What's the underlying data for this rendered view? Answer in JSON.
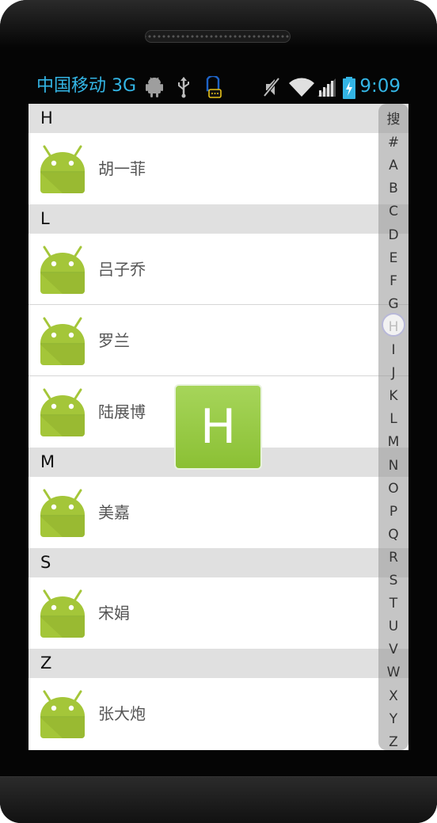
{
  "status_bar": {
    "carrier": "中国移动 3G",
    "time": "9:09",
    "icons": [
      "android-debug-icon",
      "usb-icon",
      "notification-icon",
      "mute-icon",
      "wifi-icon",
      "signal-icon",
      "battery-charging-icon"
    ]
  },
  "sections": [
    {
      "letter": "H",
      "contacts": [
        {
          "name": "胡一菲"
        }
      ]
    },
    {
      "letter": "L",
      "contacts": [
        {
          "name": "吕子乔"
        },
        {
          "name": "罗兰"
        },
        {
          "name": "陆展博"
        }
      ]
    },
    {
      "letter": "M",
      "contacts": [
        {
          "name": "美嘉"
        }
      ]
    },
    {
      "letter": "S",
      "contacts": [
        {
          "name": "宋娟"
        }
      ]
    },
    {
      "letter": "Z",
      "contacts": [
        {
          "name": "张大炮"
        }
      ]
    }
  ],
  "index_bar": {
    "items": [
      "搜",
      "#",
      "A",
      "B",
      "C",
      "D",
      "E",
      "F",
      "G",
      "H",
      "I",
      "J",
      "K",
      "L",
      "M",
      "N",
      "O",
      "P",
      "Q",
      "R",
      "S",
      "T",
      "U",
      "V",
      "W",
      "X",
      "Y",
      "Z"
    ],
    "selected": "H"
  },
  "overlay": {
    "letter": "H"
  },
  "colors": {
    "accent": "#33b5e5",
    "header_bg": "#e0e0e0",
    "android_green": "#a4c639",
    "overlay_green": "#8bc034"
  }
}
